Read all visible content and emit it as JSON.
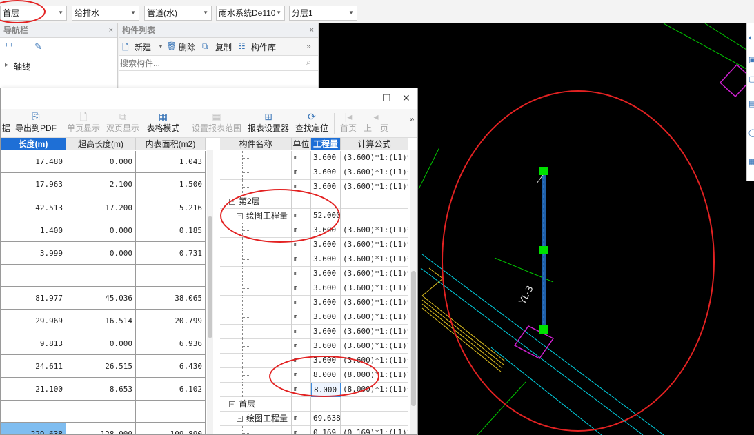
{
  "topbar": {
    "floor": "首层",
    "specialty": "给排水",
    "category": "管道(水)",
    "system": "雨水系统De110",
    "layer": "分层1"
  },
  "nav_panel": {
    "title": "导航栏",
    "close": "×",
    "tree_item": "轴线",
    "tree_caret": "▸"
  },
  "component_list": {
    "title": "构件列表",
    "close": "×",
    "new_label": "新建",
    "delete_label": "删除",
    "copy_label": "复制",
    "library_label": "构件库",
    "search_placeholder": "搜索构件...",
    "more": "»"
  },
  "report_window": {
    "toolbar": {
      "partial_label": "据",
      "export_pdf": "导出到PDF",
      "single_page": "单页显示",
      "double_page": "双页显示",
      "table_mode": "表格模式",
      "report_range": "设置报表范围",
      "report_settings": "报表设置器",
      "find_locate": "查找定位",
      "first_page": "首页",
      "prev_page": "上一页",
      "more": "»"
    },
    "left_table": {
      "headers": [
        "长度(m)",
        "超高长度(m)",
        "内表面积(m2)"
      ],
      "rows": [
        {
          "length": "17.480",
          "over": "0.000",
          "area": "1.043"
        },
        {
          "length": "17.963",
          "over": "2.100",
          "area": "1.500"
        },
        {
          "length": "42.513",
          "over": "17.200",
          "area": "5.216"
        },
        {
          "length": "1.400",
          "over": "0.000",
          "area": "0.185"
        },
        {
          "length": "3.999",
          "over": "0.000",
          "area": "0.731"
        },
        {
          "length": "",
          "over": "",
          "area": ""
        },
        {
          "length": "81.977",
          "over": "45.036",
          "area": "38.065"
        },
        {
          "length": "29.969",
          "over": "16.514",
          "area": "20.799"
        },
        {
          "length": "9.813",
          "over": "0.000",
          "area": "6.936"
        },
        {
          "length": "24.611",
          "over": "26.515",
          "area": "6.430"
        },
        {
          "length": "21.100",
          "over": "8.653",
          "area": "6.102"
        },
        {
          "length": "",
          "over": "",
          "area": ""
        },
        {
          "length": "229.638",
          "over": "128.000",
          "area": "109.890"
        }
      ]
    },
    "right_table": {
      "headers": [
        "构件名称",
        "单位",
        "工程量",
        "计算公式"
      ],
      "rows": [
        {
          "name": "",
          "unit": "m",
          "qty": "3.600",
          "formula": "(3.600)*1:(L1)*1"
        },
        {
          "name": "",
          "unit": "m",
          "qty": "3.600",
          "formula": "(3.600)*1:(L1)*1"
        },
        {
          "name": "",
          "unit": "m",
          "qty": "3.600",
          "formula": "(3.600)*1:(L1)*1"
        },
        {
          "name": "第2层",
          "unit": "",
          "qty": "",
          "formula": ""
        },
        {
          "name": "绘图工程量",
          "unit": "m",
          "qty": "52.000",
          "formula": ""
        },
        {
          "name": "",
          "unit": "m",
          "qty": "3.600",
          "formula": "(3.600)*1:(L1)*1"
        },
        {
          "name": "",
          "unit": "m",
          "qty": "3.600",
          "formula": "(3.600)*1:(L1)*1"
        },
        {
          "name": "",
          "unit": "m",
          "qty": "3.600",
          "formula": "(3.600)*1:(L1)*1"
        },
        {
          "name": "",
          "unit": "m",
          "qty": "3.600",
          "formula": "(3.600)*1:(L1)*1"
        },
        {
          "name": "",
          "unit": "m",
          "qty": "3.600",
          "formula": "(3.600)*1:(L1)*1"
        },
        {
          "name": "",
          "unit": "m",
          "qty": "3.600",
          "formula": "(3.600)*1:(L1)*1"
        },
        {
          "name": "",
          "unit": "m",
          "qty": "3.600",
          "formula": "(3.600)*1:(L1)*1"
        },
        {
          "name": "",
          "unit": "m",
          "qty": "3.600",
          "formula": "(3.600)*1:(L1)*1"
        },
        {
          "name": "",
          "unit": "m",
          "qty": "3.600",
          "formula": "(3.600)*1:(L1)*1"
        },
        {
          "name": "",
          "unit": "m",
          "qty": "3.600",
          "formula": "(3.600)*1:(L1)*1"
        },
        {
          "name": "",
          "unit": "m",
          "qty": "8.000",
          "formula": "(8.000)*1:(L1)*1"
        },
        {
          "name": "",
          "unit": "m",
          "qty": "8.000",
          "formula": "(8.000)*1:(L1)*1"
        },
        {
          "name": "首层",
          "unit": "",
          "qty": "",
          "formula": ""
        },
        {
          "name": "绘图工程量",
          "unit": "m",
          "qty": "69.638",
          "formula": ""
        },
        {
          "name": "",
          "unit": "m",
          "qty": "0.169",
          "formula": "(0.169)*1:(L1)*1"
        }
      ]
    }
  },
  "canvas": {
    "pipe_label": "YL-3"
  },
  "colors": {
    "canvas_bg": "#000000",
    "pipe": "#1f5fa8",
    "grip": "#00e000",
    "magenta": "#d020d0",
    "cyan": "#00d0e0",
    "green_line": "#00c800",
    "annotation": "#e32222",
    "header_selected": "#1e6fd6"
  }
}
